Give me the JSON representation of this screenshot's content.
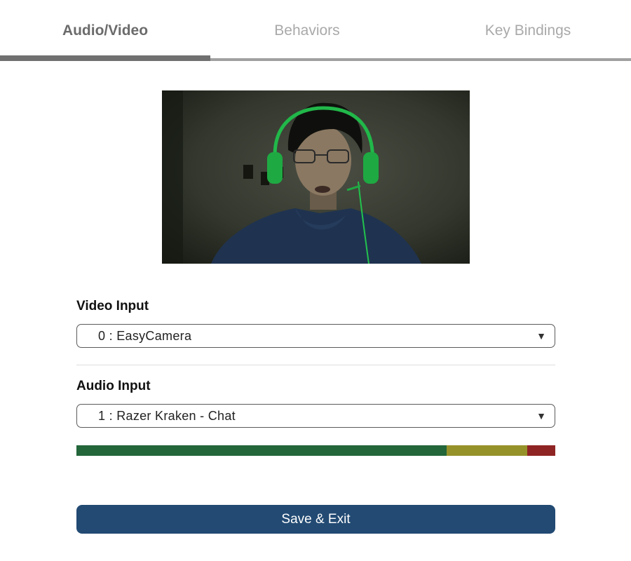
{
  "tabs": [
    {
      "label": "Audio/Video",
      "active": true
    },
    {
      "label": "Behaviors",
      "active": false
    },
    {
      "label": "Key Bindings",
      "active": false
    }
  ],
  "video": {
    "label": "Video Input",
    "selected": "0 : EasyCamera"
  },
  "audio": {
    "label": "Audio Input",
    "selected": "1 : Razer Kraken - Chat",
    "level_meter": {
      "segments": [
        {
          "zone": "normal",
          "fraction": 0.773,
          "color": "#22663a"
        },
        {
          "zone": "warning",
          "fraction": 0.168,
          "color": "#96922a"
        },
        {
          "zone": "clipping",
          "fraction": 0.059,
          "color": "#8f2424"
        }
      ]
    }
  },
  "actions": {
    "save_label": "Save & Exit"
  },
  "colors": {
    "accent": "#224a73",
    "tab_active": "#6b6b6b",
    "tab_inactive": "#a9a9a9"
  }
}
